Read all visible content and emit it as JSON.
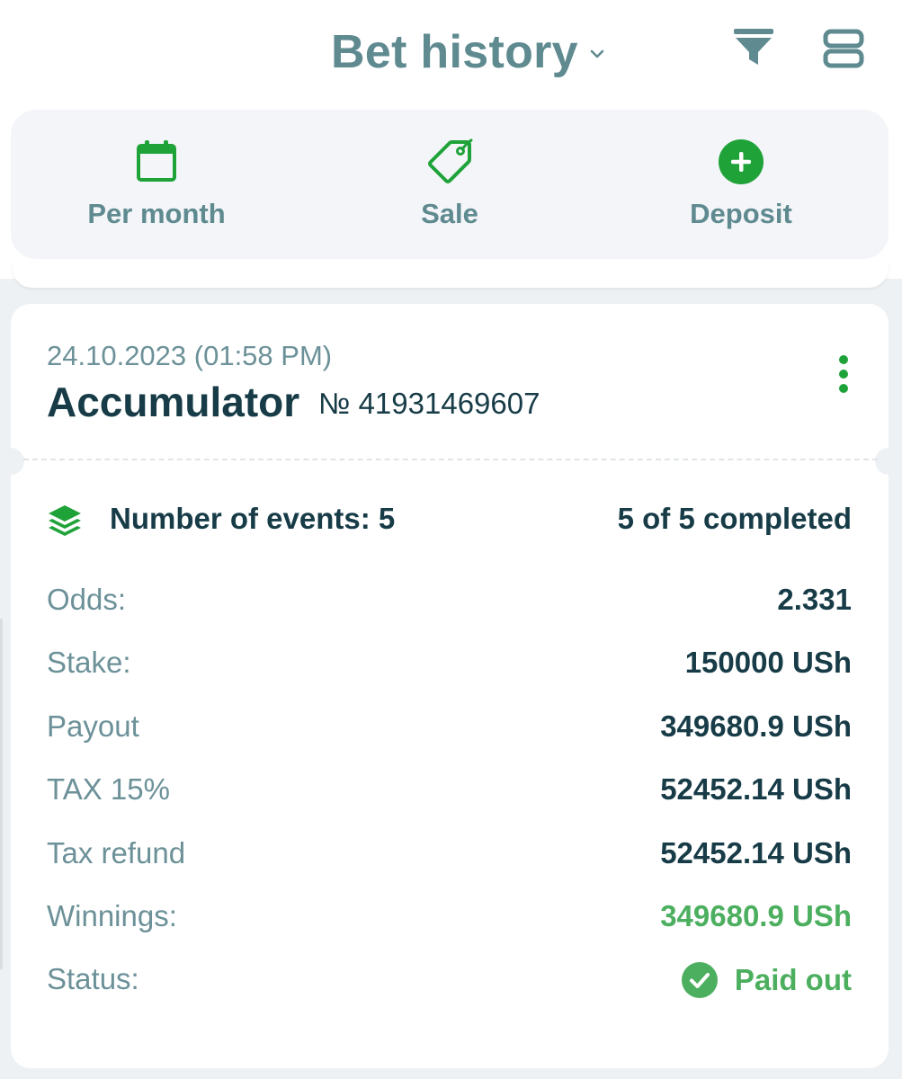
{
  "header": {
    "title": "Bet history",
    "icons": {
      "title_dropdown": "chevron-down-icon",
      "filter": "filter-icon",
      "view": "layout-toggle-icon"
    }
  },
  "quick_actions": [
    {
      "label": "Per month",
      "icon": "calendar-icon"
    },
    {
      "label": "Sale",
      "icon": "tag-icon"
    },
    {
      "label": "Deposit",
      "icon": "plus-circle-icon"
    }
  ],
  "bet": {
    "datetime": "24.10.2023 (01:58 PM)",
    "type": "Accumulator",
    "number": "№ 41931469607",
    "events_label": "Number of events: 5",
    "events_progress": "5 of 5 completed",
    "rows": [
      {
        "label": "Odds:",
        "value": "2.331"
      },
      {
        "label": "Stake:",
        "value": "150000 USh"
      },
      {
        "label": "Payout",
        "value": "349680.9 USh"
      },
      {
        "label": "TAX 15%",
        "value": "52452.14 USh"
      },
      {
        "label": "Tax refund",
        "value": "52452.14 USh"
      },
      {
        "label": "Winnings:",
        "value": "349680.9 USh"
      }
    ],
    "status": {
      "label": "Status:",
      "value": "Paid out"
    }
  },
  "colors": {
    "title": "#5e8a90",
    "accent_green": "#1fa339",
    "win_green": "#4caf5f",
    "dark_text": "#173c47",
    "muted_text": "#6c9198",
    "background": "#eef1f4"
  }
}
